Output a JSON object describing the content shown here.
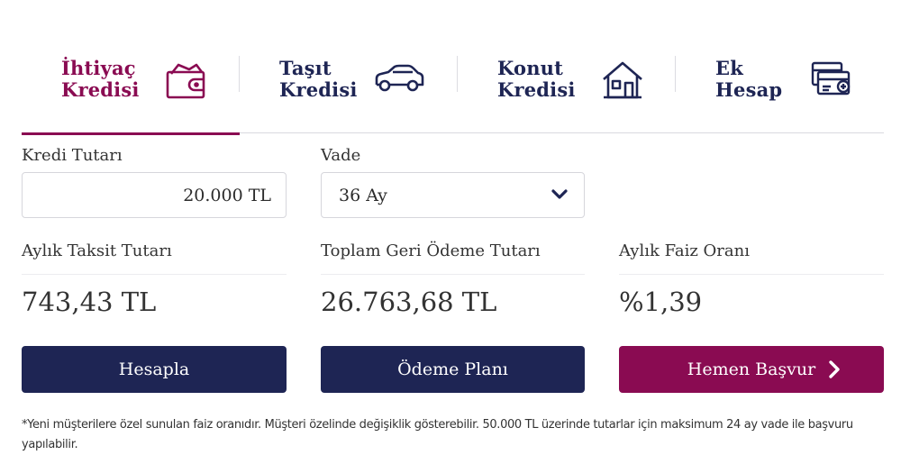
{
  "tabs": [
    {
      "line1": "İhtiyaç",
      "line2": "Kredisi",
      "icon": "wallet-icon",
      "active": true
    },
    {
      "line1": "Taşıt",
      "line2": "Kredisi",
      "icon": "car-icon",
      "active": false
    },
    {
      "line1": "Konut",
      "line2": "Kredisi",
      "icon": "house-icon",
      "active": false
    },
    {
      "line1": "Ek",
      "line2": "Hesap",
      "icon": "card-plus-icon",
      "active": false
    }
  ],
  "form": {
    "amount_label": "Kredi Tutarı",
    "amount_value": "20.000 TL",
    "term_label": "Vade",
    "term_value": "36 Ay"
  },
  "results": {
    "installment_label": "Aylık Taksit Tutarı",
    "installment_value": "743,43 TL",
    "total_label": "Toplam Geri Ödeme Tutarı",
    "total_value": "26.763,68 TL",
    "rate_label": "Aylık Faiz Oranı",
    "rate_value": "%1,39"
  },
  "buttons": {
    "calculate": "Hesapla",
    "payment_plan": "Ödeme Planı",
    "apply": "Hemen Başvur"
  },
  "footnote": "*Yeni müşterilere özel sunulan faiz oranıdır. Müşteri özelinde değişiklik gösterebilir. 50.000 TL üzerinde tutarlar için maksimum 24 ay vade ile başvuru yapılabilir.",
  "colors": {
    "primary": "#1e2554",
    "accent": "#8a0b52"
  }
}
